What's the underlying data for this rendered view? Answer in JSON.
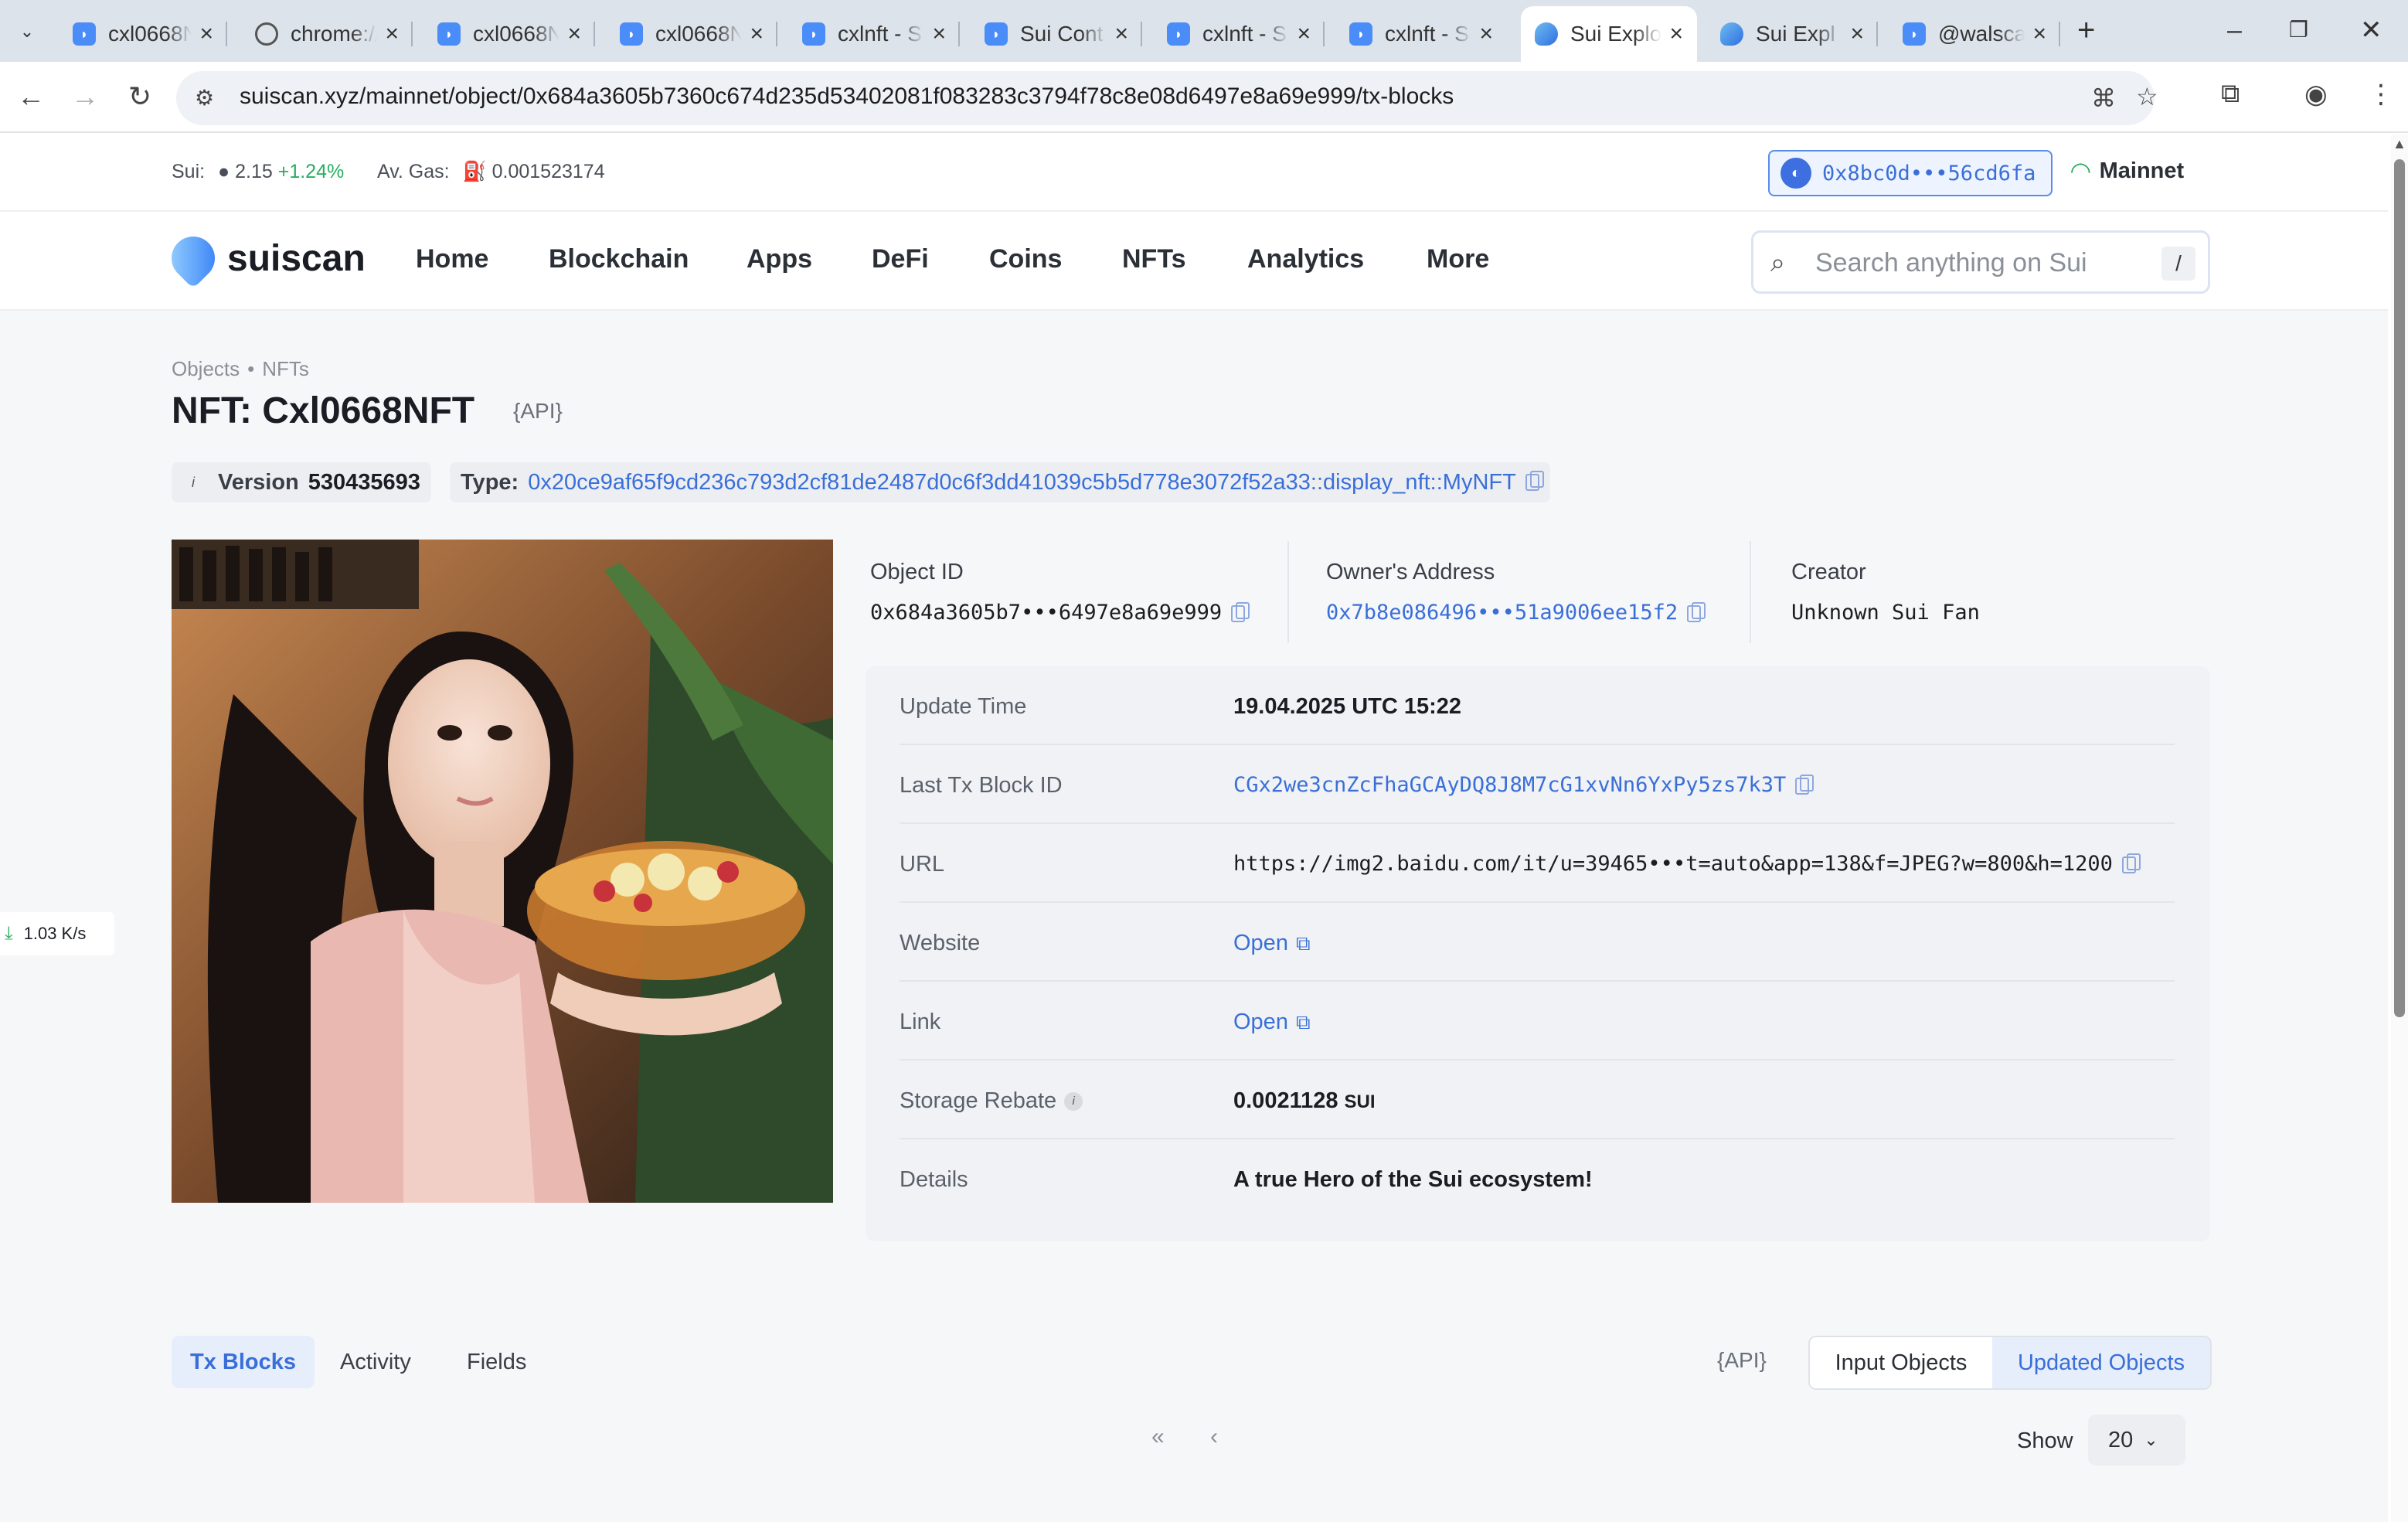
{
  "browser": {
    "tabs": [
      {
        "title": "cxl0668N",
        "icon": "sui-doc-icon"
      },
      {
        "title": "chrome://",
        "icon": "globe-icon"
      },
      {
        "title": "cxl0668N",
        "icon": "sui-doc-icon"
      },
      {
        "title": "cxl0668N",
        "icon": "sui-doc-icon"
      },
      {
        "title": "cxlnft - S",
        "icon": "sui-doc-icon"
      },
      {
        "title": "Sui Cont",
        "icon": "sui-doc-icon"
      },
      {
        "title": "cxlnft - S",
        "icon": "sui-doc-icon"
      },
      {
        "title": "cxlnft - S",
        "icon": "sui-doc-icon"
      },
      {
        "title": "Sui Explo",
        "icon": "suiscan-icon",
        "active": true
      },
      {
        "title": "Sui Expl",
        "icon": "suiscan-icon"
      },
      {
        "title": "@walsca",
        "icon": "sui-doc-icon"
      }
    ],
    "url": "suiscan.xyz/mainnet/object/0x684a3605b7360c674d235d53402081f083283c3794f78c8e08d6497e8a69e999/tx-blocks"
  },
  "topinfo": {
    "sui_label": "Sui:",
    "sui_price": "2.15",
    "sui_change": "+1.24%",
    "gas_label": "Av. Gas:",
    "gas_value": "0.001523174",
    "wallet": "0x8bc0d•••56cd6fa",
    "network": "Mainnet"
  },
  "nav": {
    "logo": "suiscan",
    "items": [
      "Home",
      "Blockchain",
      "Apps",
      "DeFi",
      "Coins",
      "NFTs",
      "Analytics",
      "More"
    ],
    "search_placeholder": "Search anything on Sui",
    "search_shortcut": "/"
  },
  "breadcrumb": [
    "Objects",
    "NFTs"
  ],
  "page": {
    "title": "NFT: Cxl0668NFT",
    "api_label": "{API}",
    "version_label": "Version",
    "version_value": "530435693",
    "type_label": "Type:",
    "type_value": "0x20ce9af65f9cd236c793d2cf81de2487d0c6f3dd41039c5b5d778e3072f52a33::display_nft::MyNFT"
  },
  "meta": {
    "object_id_label": "Object ID",
    "object_id": "0x684a3605b7•••6497e8a69e999",
    "owner_label": "Owner's Address",
    "owner": "0x7b8e086496•••51a9006ee15f2",
    "creator_label": "Creator",
    "creator": "Unknown Sui Fan"
  },
  "details": {
    "rows": [
      {
        "key": "Update Time",
        "value": "19.04.2025 UTC 15:22"
      },
      {
        "key": "Last Tx Block ID",
        "value": "CGx2we3cnZcFhaGCAyDQ8J8M7cG1xvNn6YxPy5zs7k3T"
      },
      {
        "key": "URL",
        "value": "https://img2.baidu.com/it/u=39465•••t=auto&app=138&f=JPEG?w=800&h=1200"
      },
      {
        "key": "Website",
        "value": "Open"
      },
      {
        "key": "Link",
        "value": "Open"
      },
      {
        "key": "Storage Rebate",
        "value": "0.0021128",
        "unit": "SUI"
      },
      {
        "key": "Details",
        "value": "A true Hero of the Sui ecosystem!"
      }
    ]
  },
  "subtabs": [
    "Tx Blocks",
    "Activity",
    "Fields"
  ],
  "api2": "{API}",
  "segment": [
    "Input Objects",
    "Updated Objects"
  ],
  "pagination": {
    "show_label": "Show",
    "show_value": "20"
  },
  "speed": "1.03 K/s"
}
